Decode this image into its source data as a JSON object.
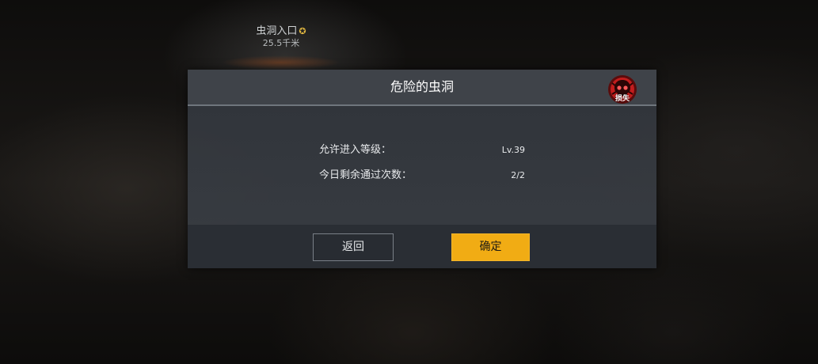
{
  "waypoint": {
    "name": "虫洞入口",
    "distance": "25.5千米"
  },
  "dialog": {
    "title": "危险的虫洞",
    "danger_badge_label": "损失",
    "rows": [
      {
        "label": "允许进入等级：",
        "value": "Lv.39"
      },
      {
        "label": "今日剩余通过次数：",
        "value": "2/2"
      }
    ],
    "buttons": {
      "back_label": "返回",
      "confirm_label": "确定"
    }
  },
  "icons": {
    "waypoint_marker": "star-icon",
    "danger": "skull-icon"
  },
  "colors": {
    "confirm_button": "#f1ac14",
    "danger_badge": "#c21d1d",
    "waypoint_marker": "#e0b640"
  }
}
